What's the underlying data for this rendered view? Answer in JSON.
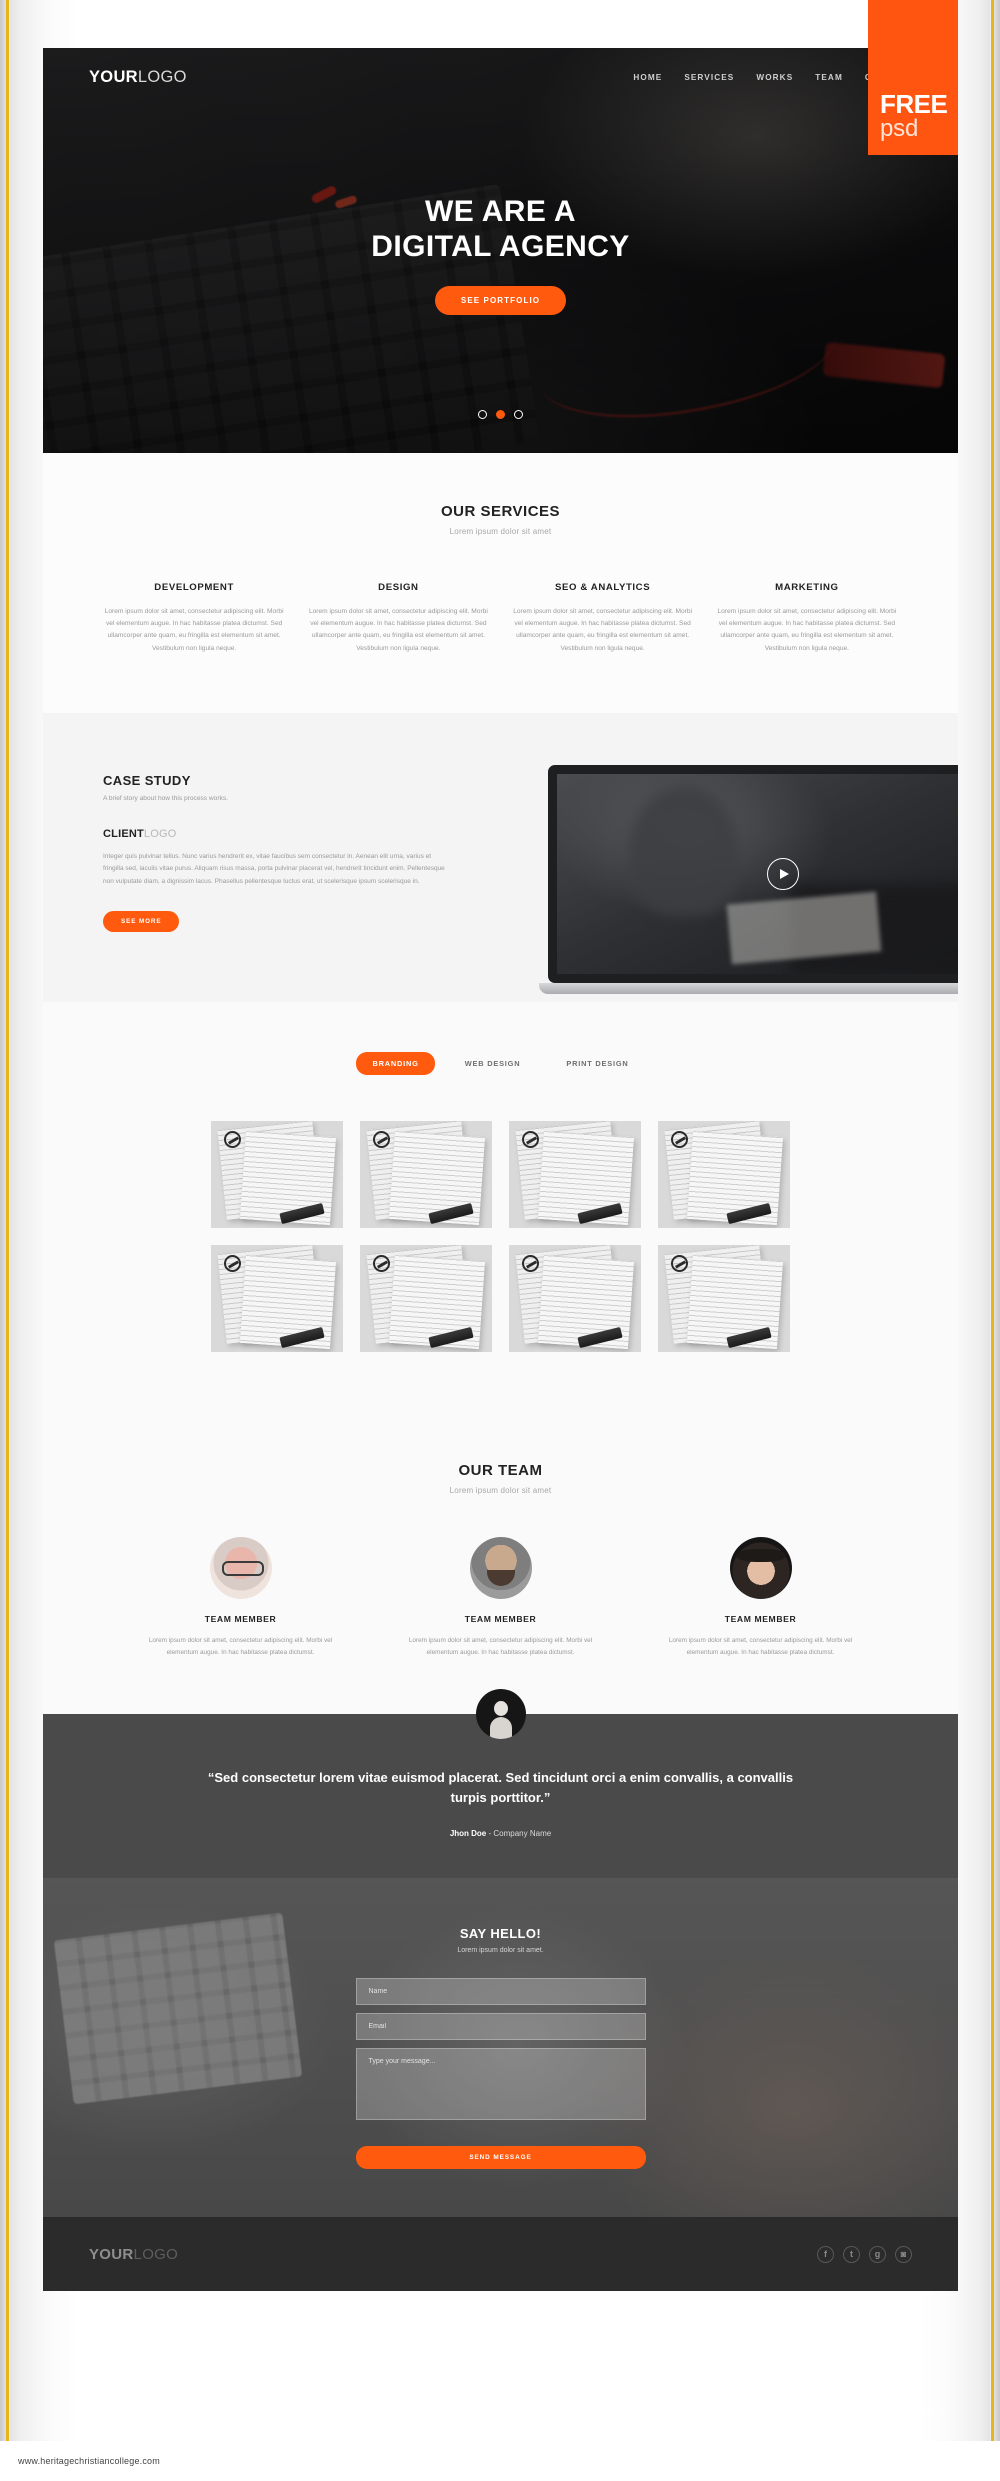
{
  "badge": {
    "line1": "FREE",
    "line2": "psd"
  },
  "watermark": {
    "url": "www.heritagechristiancollege.com"
  },
  "colors": {
    "accent": "#ff5a0e",
    "dark": "#2b2b2b",
    "testimonial_bg": "#4a4a4a"
  },
  "header": {
    "logo_bold": "YOUR",
    "logo_light": "LOGO",
    "nav": [
      {
        "label": "HOME"
      },
      {
        "label": "SERVICES"
      },
      {
        "label": "WORKS"
      },
      {
        "label": "TEAM"
      },
      {
        "label": "CONTACT"
      }
    ]
  },
  "hero": {
    "title_line1": "WE ARE A",
    "title_line2": "DIGITAL AGENCY",
    "cta": "SEE PORTFOLIO",
    "slider_dots": 3,
    "active_dot": 2
  },
  "services": {
    "title": "OUR SERVICES",
    "subtitle": "Lorem ipsum dolor sit amet",
    "items": [
      {
        "title": "DEVELOPMENT",
        "body": "Lorem ipsum dolor sit amet, consectetur adipiscing elit. Morbi vel elementum augue. In hac habitasse platea dictumst. Sed ullamcorper ante quam, eu fringilla est elementum sit amet. Vestibulum non ligula neque."
      },
      {
        "title": "DESIGN",
        "body": "Lorem ipsum dolor sit amet, consectetur adipiscing elit. Morbi vel elementum augue. In hac habitasse platea dictumst. Sed ullamcorper ante quam, eu fringilla est elementum sit amet. Vestibulum non ligula neque."
      },
      {
        "title": "SEO & ANALYTICS",
        "body": "Lorem ipsum dolor sit amet, consectetur adipiscing elit. Morbi vel elementum augue. In hac habitasse platea dictumst. Sed ullamcorper ante quam, eu fringilla est elementum sit amet. Vestibulum non ligula neque."
      },
      {
        "title": "MARKETING",
        "body": "Lorem ipsum dolor sit amet, consectetur adipiscing elit. Morbi vel elementum augue. In hac habitasse platea dictumst. Sed ullamcorper ante quam, eu fringilla est elementum sit amet. Vestibulum non ligula neque."
      }
    ]
  },
  "case_study": {
    "title": "CASE STUDY",
    "brief": "A brief story about how this process works.",
    "client_bold": "CLIENT",
    "client_light": "LOGO",
    "body": "Integer quis pulvinar tellus. Nunc varius hendrerit ex, vitae faucibus sem consectetur in. Aenean elit urna, varius et fringilla sed, iaculis vitae purus. Aliquam risus massa, porta pulvinar placerat vel, hendrerit tincidunt enim. Pellentesque non vulputate diam, a dignissim lacus. Phasellus pellentesque luctus erat, ut scelerisque ipsum scelerisque in.",
    "cta": "SEE MORE",
    "video_play": "play-icon"
  },
  "portfolio": {
    "tabs": [
      {
        "label": "BRANDING",
        "active": true
      },
      {
        "label": "WEB DESIGN",
        "active": false
      },
      {
        "label": "PRINT DESIGN",
        "active": false
      }
    ],
    "item_count": 8
  },
  "team": {
    "title": "OUR TEAM",
    "subtitle": "Lorem ipsum dolor sit amet",
    "members": [
      {
        "name": "TEAM MEMBER",
        "body": "Lorem ipsum dolor sit amet, consectetur adipiscing elit. Morbi vel elementum augue. In hac habitasse platea dictumst."
      },
      {
        "name": "TEAM MEMBER",
        "body": "Lorem ipsum dolor sit amet, consectetur adipiscing elit. Morbi vel elementum augue. In hac habitasse platea dictumst."
      },
      {
        "name": "TEAM MEMBER",
        "body": "Lorem ipsum dolor sit amet, consectetur adipiscing elit. Morbi vel elementum augue. In hac habitasse platea dictumst."
      }
    ]
  },
  "testimonial": {
    "quote": "“Sed consectetur lorem vitae euismod placerat. Sed tincidunt orci a enim convallis, a convallis turpis porttitor.”",
    "author": "Jhon Doe",
    "separator": " - ",
    "company": "Company Name"
  },
  "contact": {
    "title": "SAY HELLO!",
    "subtitle": "Lorem ipsum dolor sit amet.",
    "name_placeholder": "Name",
    "email_placeholder": "Email",
    "message_placeholder": "Type your message...",
    "name_value": "",
    "email_value": "",
    "message_value": "",
    "submit": "SEND MESSAGE"
  },
  "footer": {
    "logo_bold": "YOUR",
    "logo_light": "LOGO",
    "social": [
      {
        "icon": "facebook-icon",
        "glyph": "f"
      },
      {
        "icon": "twitter-icon",
        "glyph": "t"
      },
      {
        "icon": "google-plus-icon",
        "glyph": "g"
      },
      {
        "icon": "instagram-icon",
        "glyph": "◙"
      }
    ]
  }
}
